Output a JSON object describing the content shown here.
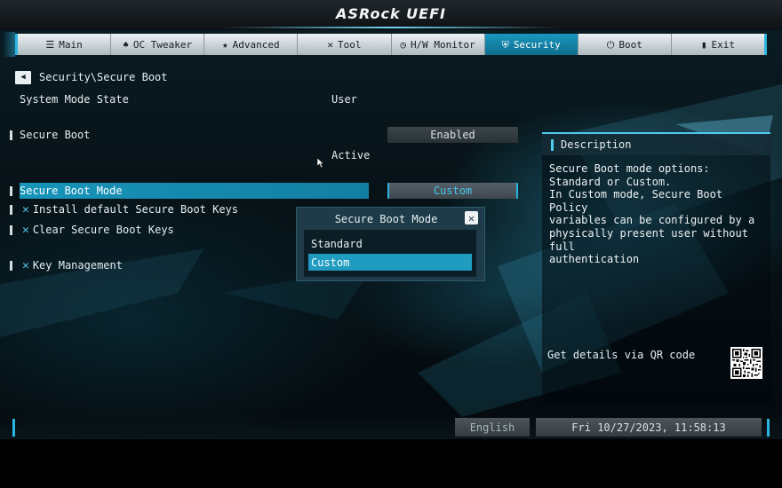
{
  "brand": "ASRock UEFI",
  "tabs": [
    {
      "label": "Main",
      "icon": "list-icon",
      "glyph": "☰"
    },
    {
      "label": "OC Tweaker",
      "icon": "rocket-icon",
      "glyph": "♠"
    },
    {
      "label": "Advanced",
      "icon": "star-icon",
      "glyph": "★"
    },
    {
      "label": "Tool",
      "icon": "wrench-icon",
      "glyph": "✕"
    },
    {
      "label": "H/W Monitor",
      "icon": "gauge-icon",
      "glyph": "◷"
    },
    {
      "label": "Security",
      "icon": "shield-icon",
      "glyph": "⛨"
    },
    {
      "label": "Boot",
      "icon": "power-icon",
      "glyph": "⏻"
    },
    {
      "label": "Exit",
      "icon": "exit-door-icon",
      "glyph": "▮"
    }
  ],
  "active_tab": "Security",
  "breadcrumb": "Security\\Secure Boot",
  "settings": {
    "system_mode_state": {
      "label": "System Mode State",
      "value": "User"
    },
    "secure_boot": {
      "label": "Secure Boot",
      "value": "Enabled",
      "status": "Active"
    },
    "secure_boot_mode": {
      "label": "Secure Boot Mode",
      "value": "Custom"
    },
    "install_keys": {
      "label": "Install default Secure Boot Keys"
    },
    "clear_keys": {
      "label": "Clear Secure Boot Keys"
    },
    "key_management": {
      "label": "Key Management"
    }
  },
  "popup": {
    "title": "Secure Boot Mode",
    "options": [
      "Standard",
      "Custom"
    ],
    "selected": "Custom"
  },
  "description": {
    "header": "Description",
    "text": "Secure Boot mode options:\nStandard or Custom.\nIn Custom mode, Secure Boot Policy\nvariables can be configured by a\nphysically present user without full\nauthentication",
    "qr_label": "Get details via QR code"
  },
  "footer": {
    "language": "English",
    "datetime": "Fri 10/27/2023, 11:58:13"
  },
  "colors": {
    "accent": "#1f9cc0",
    "highlight": "#48c7ec",
    "tab_active": "#1a97bf"
  }
}
